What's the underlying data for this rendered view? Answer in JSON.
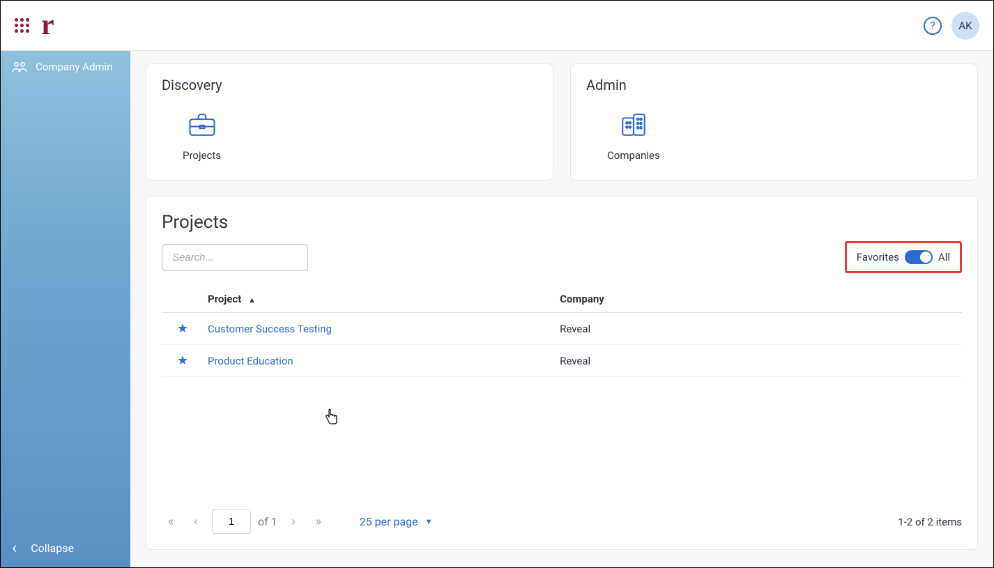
{
  "topbar": {
    "logo_text": "r",
    "help_label": "?",
    "avatar_initials": "AK"
  },
  "sidebar": {
    "item_label": "Company Admin",
    "collapse_label": "Collapse"
  },
  "cards": {
    "discovery": {
      "title": "Discovery",
      "tile_label": "Projects"
    },
    "admin": {
      "title": "Admin",
      "tile_label": "Companies"
    }
  },
  "projects": {
    "title": "Projects",
    "search_placeholder": "Search...",
    "favorites_label": "Favorites",
    "all_label": "All",
    "columns": {
      "project": "Project",
      "company": "Company"
    },
    "rows": [
      {
        "name": "Customer Success Testing",
        "company": "Reveal"
      },
      {
        "name": "Product Education",
        "company": "Reveal"
      }
    ],
    "pager": {
      "page_value": "1",
      "of_label": "of 1",
      "per_page_label": "25 per page",
      "items_count": "1-2 of 2 items"
    }
  }
}
